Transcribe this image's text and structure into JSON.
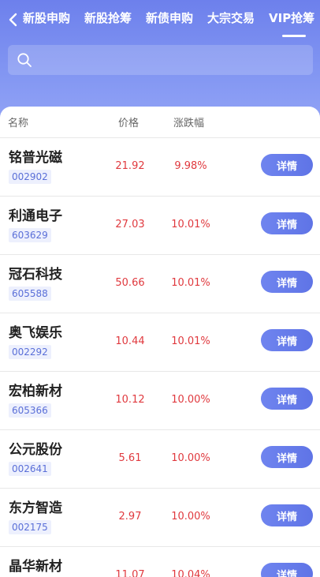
{
  "nav": {
    "tabs": [
      {
        "label": "新股申购"
      },
      {
        "label": "新股抢筹"
      },
      {
        "label": "新债申购"
      },
      {
        "label": "大宗交易"
      },
      {
        "label": "VIP抢筹"
      }
    ],
    "active_tab": "VIP抢筹"
  },
  "search": {
    "placeholder": "",
    "value": ""
  },
  "table": {
    "headers": {
      "name": "名称",
      "price": "价格",
      "change": "涨跌幅"
    },
    "detail_label": "详情",
    "rows": [
      {
        "name": "铭普光磁",
        "code": "002902",
        "price": "21.92",
        "change": "9.98%"
      },
      {
        "name": "利通电子",
        "code": "603629",
        "price": "27.03",
        "change": "10.01%"
      },
      {
        "name": "冠石科技",
        "code": "605588",
        "price": "50.66",
        "change": "10.01%"
      },
      {
        "name": "奥飞娱乐",
        "code": "002292",
        "price": "10.44",
        "change": "10.01%"
      },
      {
        "name": "宏柏新材",
        "code": "605366",
        "price": "10.12",
        "change": "10.00%"
      },
      {
        "name": "公元股份",
        "code": "002641",
        "price": "5.61",
        "change": "10.00%"
      },
      {
        "name": "东方智造",
        "code": "002175",
        "price": "2.97",
        "change": "10.00%"
      },
      {
        "name": "晶华新材",
        "code": "",
        "price": "11.07",
        "change": "10.04%"
      }
    ]
  },
  "colors": {
    "header_gradient_top": "#6d80ec",
    "header_gradient_bottom": "#93a4f6",
    "accent": "#6f84ef",
    "up_red": "#e0393e",
    "code_blue": "#5a6fd8"
  }
}
